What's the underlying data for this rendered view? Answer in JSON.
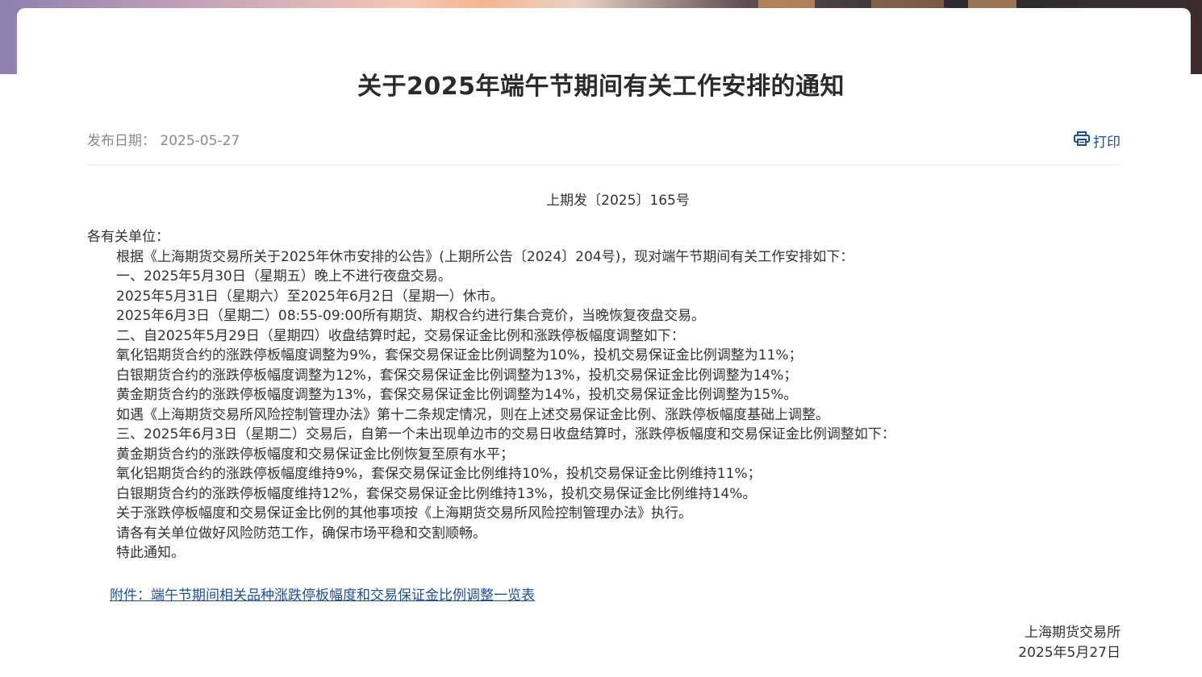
{
  "title": "关于2025年端午节期间有关工作安排的通知",
  "meta": {
    "date_label": "发布日期：",
    "date_value": "2025-05-27",
    "print_label": "打印"
  },
  "doc_number": "上期发〔2025〕165号",
  "salutation": "各有关单位：",
  "paragraphs": [
    "根据《上海期货交易所关于2025年休市安排的公告》(上期所公告〔2024〕204号)，现对端午节期间有关工作安排如下：",
    "一、2025年5月30日（星期五）晚上不进行夜盘交易。",
    "2025年5月31日（星期六）至2025年6月2日（星期一）休市。",
    "2025年6月3日（星期二）08:55-09:00所有期货、期权合约进行集合竞价，当晚恢复夜盘交易。",
    "二、自2025年5月29日（星期四）收盘结算时起，交易保证金比例和涨跌停板幅度调整如下：",
    "氧化铝期货合约的涨跌停板幅度调整为9%，套保交易保证金比例调整为10%，投机交易保证金比例调整为11%；",
    "白银期货合约的涨跌停板幅度调整为12%，套保交易保证金比例调整为13%，投机交易保证金比例调整为14%；",
    "黄金期货合约的涨跌停板幅度调整为13%，套保交易保证金比例调整为14%，投机交易保证金比例调整为15%。",
    "如遇《上海期货交易所风险控制管理办法》第十二条规定情况，则在上述交易保证金比例、涨跌停板幅度基础上调整。",
    "三、2025年6月3日（星期二）交易后，自第一个未出现单边市的交易日收盘结算时，涨跌停板幅度和交易保证金比例调整如下：",
    "黄金期货合约的涨跌停板幅度和交易保证金比例恢复至原有水平；",
    "氧化铝期货合约的涨跌停板幅度维持9%，套保交易保证金比例维持10%，投机交易保证金比例维持11%；",
    "白银期货合约的涨跌停板幅度维持12%，套保交易保证金比例维持13%，投机交易保证金比例维持14%。",
    "关于涨跌停板幅度和交易保证金比例的其他事项按《上海期货交易所风险控制管理办法》执行。",
    "请各有关单位做好风险防范工作，确保市场平稳和交割顺畅。",
    "特此通知。"
  ],
  "attachment": "附件：端午节期间相关品种涨跌停板幅度和交易保证金比例调整一览表",
  "signature": {
    "org": "上海期货交易所",
    "date": "2025年5月27日"
  },
  "colors": {
    "link": "#1e4f99",
    "meta_gray": "#8a8a8a",
    "text": "#333333"
  },
  "icons": {
    "print": "printer-icon"
  }
}
